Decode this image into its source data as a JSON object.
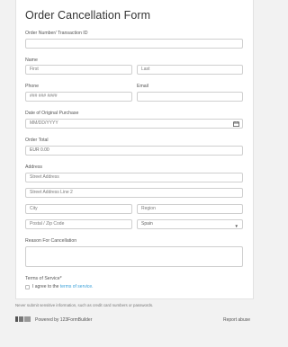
{
  "form": {
    "title": "Order Cancellation Form",
    "order_number": {
      "label": "Order Number/ Transaction ID",
      "value": ""
    },
    "name": {
      "label": "Name",
      "first_placeholder": "First",
      "last_placeholder": "Last"
    },
    "phone": {
      "label": "Phone",
      "placeholder": "### ### ####"
    },
    "email": {
      "label": "Email",
      "value": ""
    },
    "date": {
      "label": "Date of Original Purchase",
      "placeholder": "MM/DD/YYYY",
      "icon": "calendar-icon"
    },
    "total": {
      "label": "Order Total",
      "value": "EUR  0.00"
    },
    "address": {
      "label": "Address",
      "street_placeholder": "Street Address",
      "street2_placeholder": "Street Address Line 2",
      "city_placeholder": "City",
      "region_placeholder": "Region",
      "postal_placeholder": "Postal / Zip Code",
      "country_value": "Spain"
    },
    "reason": {
      "label": "Reason For Cancellation",
      "value": ""
    },
    "terms": {
      "label": "Terms of Service*",
      "agree_text": "I agree to the",
      "link_text": "terms of service."
    }
  },
  "notice": "Never submit sensitive information, such as credit card numbers or passwords.",
  "footer": {
    "powered_by": "Powered by 123FormBuilder",
    "report": "Report abuse"
  }
}
